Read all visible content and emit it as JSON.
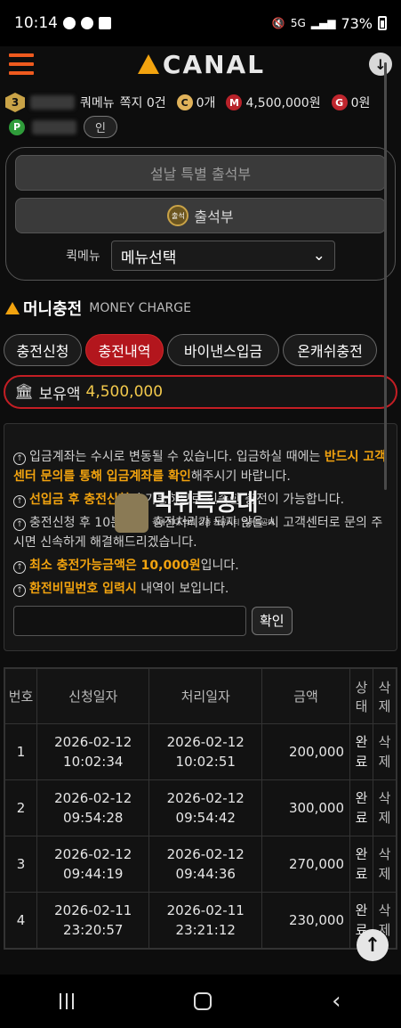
{
  "status_bar": {
    "time": "10:14",
    "battery": "73%",
    "net": "5G"
  },
  "header": {
    "logo_text": "CANAL"
  },
  "user": {
    "level": "3",
    "menu_text": "쿼메뉴",
    "notice_count_text": "쪽지 0건",
    "coupon_label": "C",
    "coupon_count": "0개",
    "money_label": "M",
    "money": "4,500,000원",
    "gold_label": "G",
    "gold": "0원",
    "point_label": "P",
    "point_button": "인"
  },
  "attendance": {
    "special_button": "설날 특별 출석부",
    "icon_text": "출석",
    "attendance_button": "출석부",
    "quick_label": "퀵메뉴",
    "quick_select": "메뉴선택"
  },
  "section": {
    "title_ko": "머니충전",
    "title_en": "MONEY CHARGE"
  },
  "tabs": [
    {
      "label": "충전신청"
    },
    {
      "label": "충전내역"
    },
    {
      "label": "바이낸스입금"
    },
    {
      "label": "온캐쉬충전"
    }
  ],
  "balance": {
    "label": "보유액",
    "value": "4,500,000"
  },
  "notice": {
    "l1_a": "입금계좌는 수시로 변동될 수 있습니다. 입금하실 때에는 ",
    "l1_b": "반드시 고객센터 문의를 통해 입금계좌를 확인",
    "l1_c": "해주시기 바랍니다.",
    "l2_a": "선입금 후 충전신",
    "l2_b": "청",
    "l2_c": "이 가능하므로 신속한 충전이 가능합니다.",
    "l3": "충전신청 후 10분 이내 충전처리가 되지 않을 시 고객센터로 문의 주시면 신속하게 해결해드리겠습니다.",
    "l4_a": "최소 충전가능금액은 10,000원",
    "l4_b": "입니다.",
    "l5_a": "환전비밀번호 입력시",
    "l5_b": " 내역이 보입니다.",
    "confirm_button": "확인",
    "watermark_title": "먹튀특공대",
    "watermark_sub": "국내 최대 먹튀 검증 커뮤니티 먹튀특공대"
  },
  "table": {
    "headers": [
      "번호",
      "신청일자",
      "처리일자",
      "금액",
      "상태",
      "삭제"
    ],
    "rows": [
      {
        "no": "1",
        "req_date": "2026-02-12",
        "req_time": "10:02:34",
        "proc_date": "2026-02-12",
        "proc_time": "10:02:51",
        "amount": "200,000",
        "status": "완료",
        "del": "삭제"
      },
      {
        "no": "2",
        "req_date": "2026-02-12",
        "req_time": "09:54:28",
        "proc_date": "2026-02-12",
        "proc_time": "09:54:42",
        "amount": "300,000",
        "status": "완료",
        "del": "삭제"
      },
      {
        "no": "3",
        "req_date": "2026-02-12",
        "req_time": "09:44:19",
        "proc_date": "2026-02-12",
        "proc_time": "09:44:36",
        "amount": "270,000",
        "status": "완료",
        "del": "삭제"
      },
      {
        "no": "4",
        "req_date": "2026-02-11",
        "req_time": "23:20:57",
        "proc_date": "2026-02-11",
        "proc_time": "23:21:12",
        "amount": "230,000",
        "status": "완료",
        "del": "삭제"
      }
    ]
  }
}
